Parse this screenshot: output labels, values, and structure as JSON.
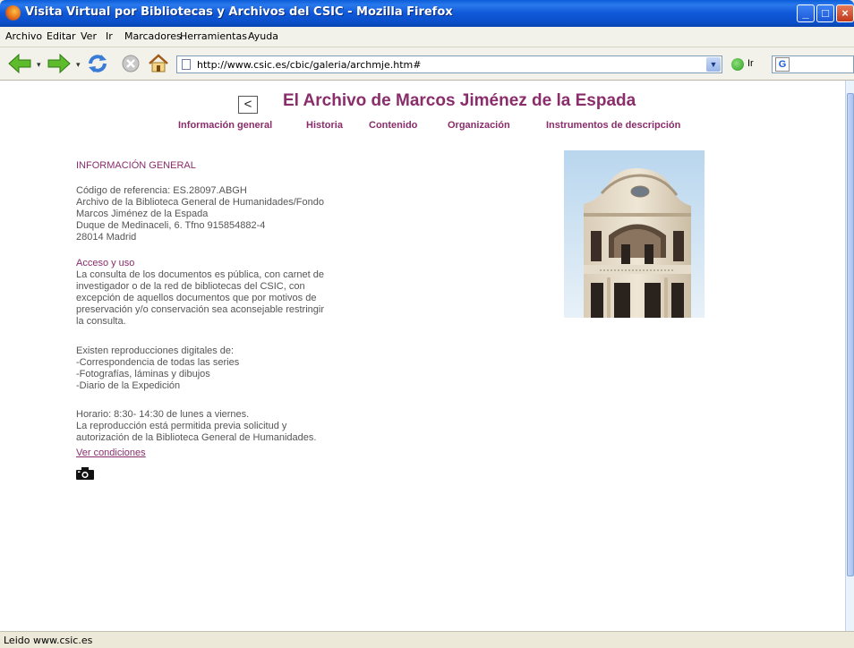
{
  "window": {
    "title": "Visita Virtual por Bibliotecas y Archivos del CSIC - Mozilla Firefox"
  },
  "menu": [
    "Archivo",
    "Editar",
    "Ver",
    "Ir",
    "Marcadores",
    "Herramientas",
    "Ayuda"
  ],
  "nav": {
    "url": "http://www.csic.es/cbic/galeria/archmje.htm#",
    "go_label": "Ir"
  },
  "page": {
    "back_symbol": "<",
    "title": "El Archivo de Marcos Jiménez de la Espada",
    "tabs": [
      "Información general",
      "Historia",
      "Contenido",
      "Organización",
      "Instrumentos de descripción"
    ],
    "section_title": "INFORMACIÓN GENERAL",
    "reference_lines": [
      "Código de referencia: ES.28097.ABGH",
      "Archivo de la Biblioteca General de Humanidades/Fondo",
      "Marcos Jiménez de la Espada",
      "Duque de Medinaceli, 6. Tfno 915854882-4",
      "28014 Madrid"
    ],
    "access_title": "Acceso y uso",
    "access_lines": [
      "La consulta de los documentos es pública, con carnet de",
      "investigador o de la red de bibliotecas del CSIC, con",
      "excepción de aquellos documentos que por motivos de",
      "preservación y/o conservación sea aconsejable restringir",
      "la consulta."
    ],
    "repro_lines": [
      "Existen reproducciones digitales de:",
      "-Correspondencia de todas las series",
      "-Fotografías, láminas y dibujos",
      "-Diario de la Expedición"
    ],
    "hours_lines": [
      "Horario: 8:30- 14:30 de lunes a viernes.",
      "La reproducción está permitida previa solicitud y",
      "autorización de la Biblioteca General de Humanidades."
    ],
    "conditions_link": "Ver condiciones"
  },
  "status": "Leido www.csic.es",
  "colors": {
    "accent": "#8a2d6b",
    "body_text": "#555555",
    "titlebar": "#0a5cd8"
  }
}
